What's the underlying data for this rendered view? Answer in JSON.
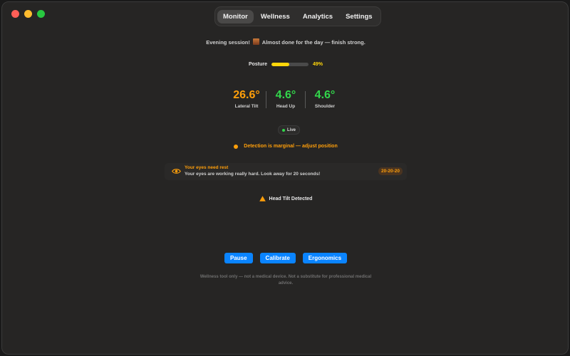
{
  "tabs": [
    {
      "label": "Monitor",
      "active": true
    },
    {
      "label": "Wellness",
      "active": false
    },
    {
      "label": "Analytics",
      "active": false
    },
    {
      "label": "Settings",
      "active": false
    }
  ],
  "session_message": {
    "prefix": "Evening session!",
    "emoji_icon": "sunset-icon",
    "suffix": "Almost done for the day — finish strong."
  },
  "posture": {
    "label": "Posture",
    "percent": 49,
    "percent_text": "49%",
    "color": "#ffd60a"
  },
  "metrics": [
    {
      "value": "26.6°",
      "label": "Lateral Tilt",
      "color": "#ff9f0a"
    },
    {
      "value": "4.6°",
      "label": "Head Up",
      "color": "#32d74b"
    },
    {
      "value": "4.6°",
      "label": "Shoulder",
      "color": "#32d74b"
    }
  ],
  "live": {
    "label": "Live",
    "color": "#32d74b"
  },
  "detection_warning": "Detection is marginal — adjust position",
  "eye_rest": {
    "title": "Your eyes need rest",
    "message": "Your eyes are working really hard. Look away for 20 seconds!",
    "badge": "20-20-20",
    "icon": "eye-icon"
  },
  "alert": {
    "icon": "warning-triangle-icon",
    "label": "Head Tilt Detected"
  },
  "buttons": {
    "pause": "Pause",
    "calibrate": "Calibrate",
    "ergonomics": "Ergonomics"
  },
  "disclaimer": "Wellness tool only — not a medical device. Not a substitute for professional medical advice.",
  "colors": {
    "accent": "#0a84ff",
    "warning": "#ff9f0a",
    "good": "#32d74b"
  }
}
